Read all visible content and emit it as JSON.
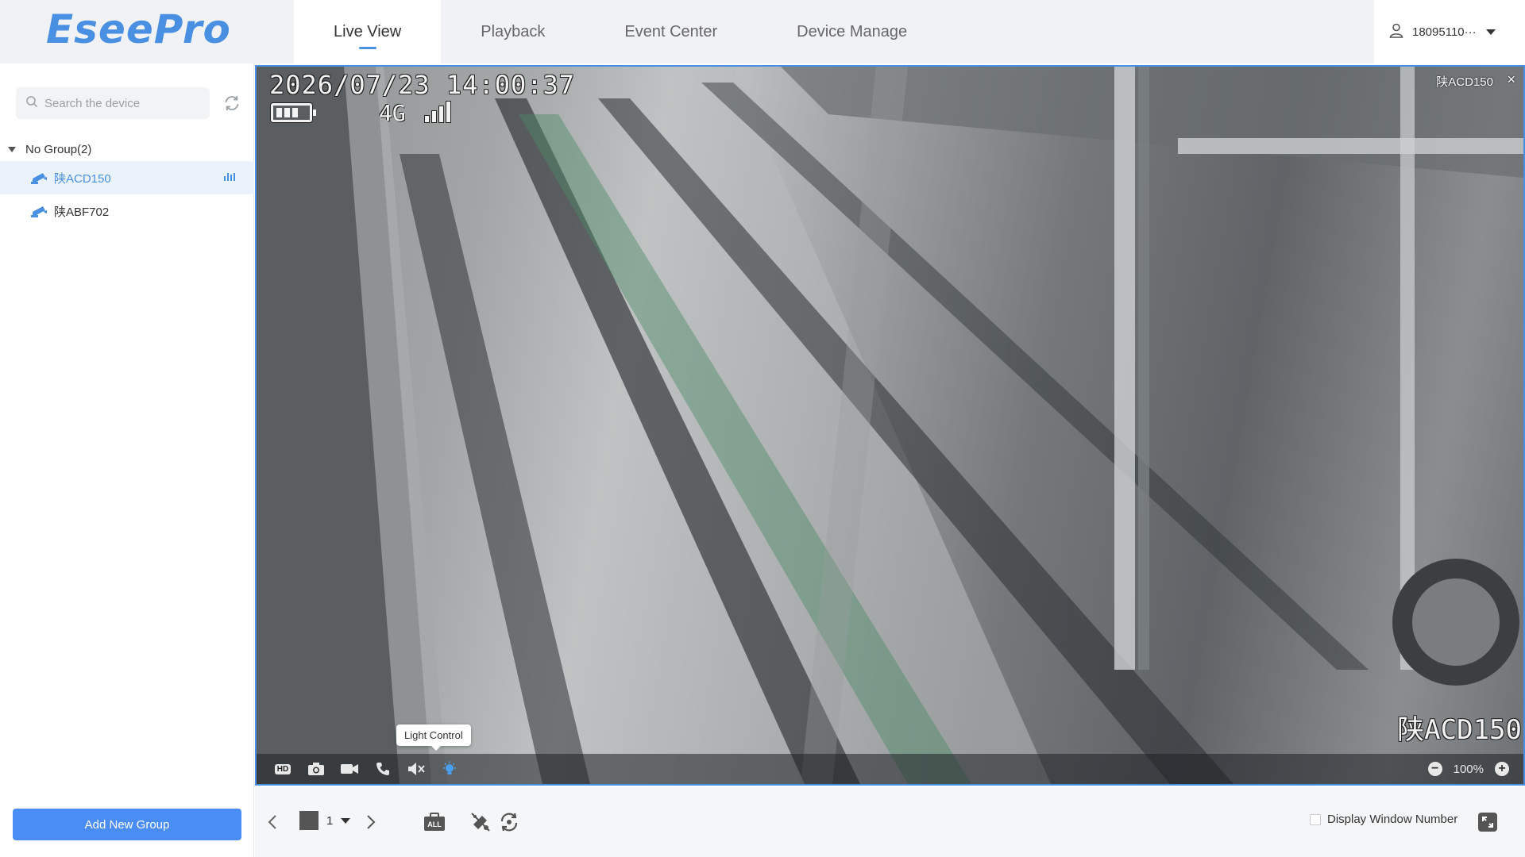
{
  "app": {
    "logo": "EseePro"
  },
  "nav": {
    "tabs": [
      {
        "label": "Live View",
        "active": true
      },
      {
        "label": "Playback"
      },
      {
        "label": "Event Center"
      },
      {
        "label": "Device Manage"
      }
    ]
  },
  "user": {
    "name": "18095110···",
    "icon": "user-icon"
  },
  "sidebar": {
    "search": {
      "placeholder": "Search the device",
      "value": ""
    },
    "group": {
      "label": "No Group(2)",
      "expanded": true
    },
    "devices": [
      {
        "name": "陕ACD150",
        "selected": true,
        "streaming": true
      },
      {
        "name": "陕ABF702",
        "selected": false
      }
    ],
    "add_group_label": "Add New Group"
  },
  "video": {
    "window_title": "陕ACD150",
    "close_glyph": "×",
    "osd": {
      "timestamp": "2026/07/23 14:00:37",
      "network": "4G",
      "device_name": "陕ACD150"
    },
    "toolbar": {
      "hd_label": "HD",
      "tooltip": "Light Control",
      "zoom_level": "100%"
    }
  },
  "bottom": {
    "layout_value": "1",
    "display_window_number_label": "Display Window Number",
    "all_label": "ALL"
  },
  "colors": {
    "accent": "#4a90e2",
    "button": "#4a8ef5",
    "header_bg": "#f0f2f5"
  }
}
